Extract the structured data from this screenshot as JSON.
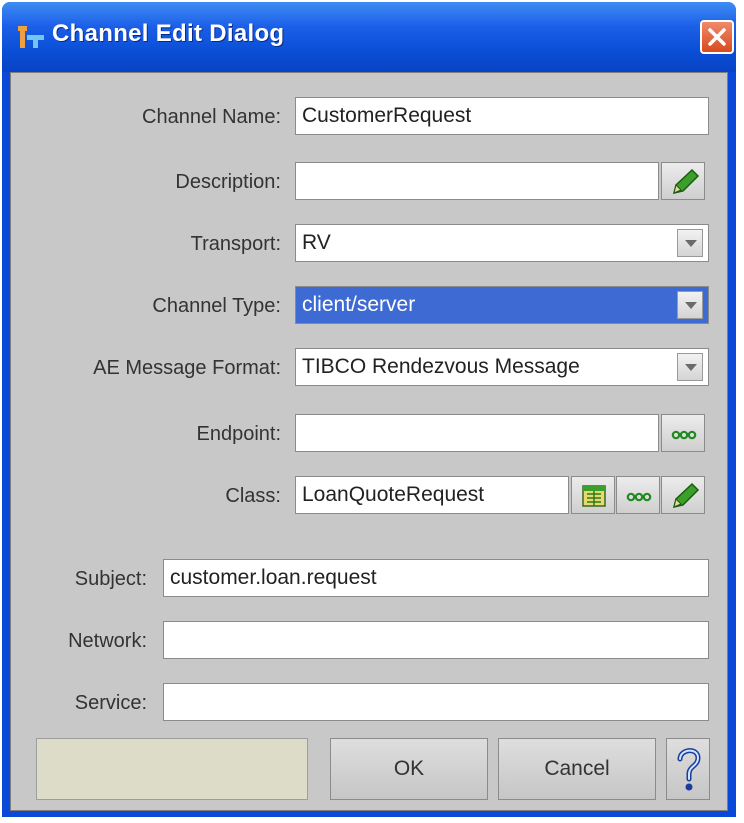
{
  "window": {
    "title": "Channel Edit Dialog"
  },
  "fields": {
    "channel_name": {
      "label": "Channel Name:",
      "value": "CustomerRequest"
    },
    "description": {
      "label": "Description:",
      "value": ""
    },
    "transport": {
      "label": "Transport:",
      "value": "RV"
    },
    "channel_type": {
      "label": "Channel Type:",
      "value": "client/server"
    },
    "ae_message_format": {
      "label": "AE Message Format:",
      "value": "TIBCO Rendezvous Message"
    },
    "endpoint": {
      "label": "Endpoint:",
      "value": ""
    },
    "class": {
      "label": "Class:",
      "value": "LoanQuoteRequest"
    },
    "subject": {
      "label": "Subject:",
      "value": "customer.loan.request"
    },
    "network": {
      "label": "Network:",
      "value": ""
    },
    "service": {
      "label": "Service:",
      "value": ""
    }
  },
  "buttons": {
    "ok": "OK",
    "cancel": "Cancel"
  },
  "icons": {
    "app": "app-icon",
    "close": "close-icon",
    "edit": "pencil-icon",
    "browse": "ellipsis-icon",
    "select_class": "class-browser-icon",
    "help": "question-mark-icon"
  },
  "colors": {
    "titlebar": "#0a4fd6",
    "client_bg": "#c8c8c8",
    "selection": "#3d6ad3",
    "close": "#d84a1e"
  }
}
